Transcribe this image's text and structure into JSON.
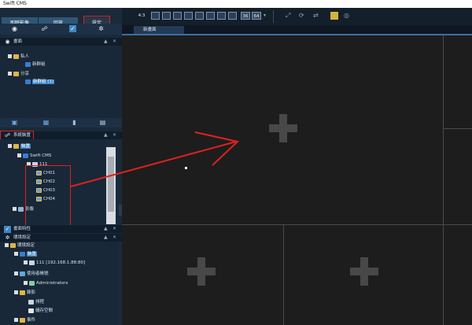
{
  "app": {
    "title": "Swift CMS"
  },
  "tabs": {
    "live": "即時影像",
    "playback": "回放",
    "settings": "設定"
  },
  "page_panel": {
    "header": "畫面",
    "items": [
      {
        "label": "私人"
      },
      {
        "label": "新群組"
      },
      {
        "label": "分享"
      },
      {
        "label": "新群組 (1)"
      }
    ]
  },
  "system_panel": {
    "header": "系統裝置",
    "items": [
      {
        "label": "裝置"
      },
      {
        "label": "Swift CMS"
      },
      {
        "label": "111"
      },
      {
        "label": "CH01"
      },
      {
        "label": "CH02"
      },
      {
        "label": "CH03"
      },
      {
        "label": "CH04"
      },
      {
        "label": "影像"
      }
    ]
  },
  "props_panel": {
    "header": "畫面特性"
  },
  "env_panel": {
    "header": "環境設定",
    "items": [
      {
        "label": "環境設定"
      },
      {
        "label": "裝置"
      },
      {
        "label": "111 [192.168.1.88:80]"
      },
      {
        "label": "使用者帳號"
      },
      {
        "label": "Administrators"
      },
      {
        "label": "錄影"
      },
      {
        "label": "排程"
      },
      {
        "label": "儲存空間"
      },
      {
        "label": "事件"
      }
    ]
  },
  "toolbar": {
    "ratio": "4:3",
    "layout_36": "36",
    "layout_64": "64"
  },
  "view": {
    "tab_label": "新畫面"
  },
  "colors": {
    "accent_red": "#e02020",
    "panel_bg": "#1a2a3a",
    "selection": "#3d86c7"
  }
}
